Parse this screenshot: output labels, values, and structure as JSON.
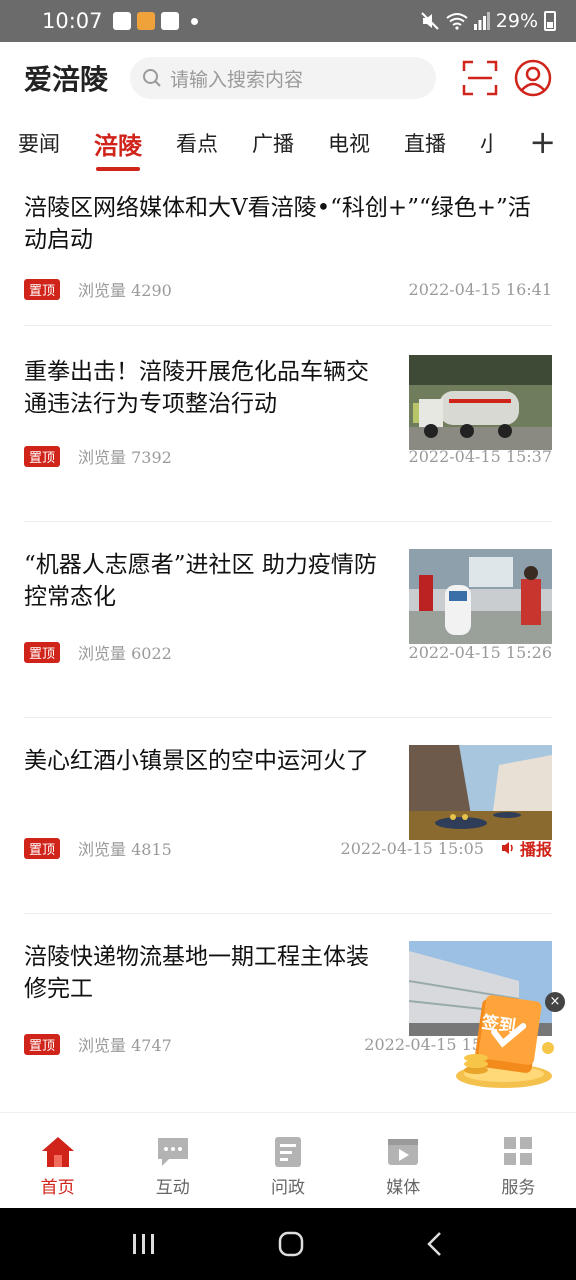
{
  "status_bar": {
    "time": "10:07",
    "battery": "29%"
  },
  "header": {
    "logo": "爱涪陵",
    "search_placeholder": "请输入搜索内容"
  },
  "tabs": [
    "要闻",
    "涪陵",
    "看点",
    "广播",
    "电视",
    "直播",
    "小"
  ],
  "active_tab": "涪陵",
  "tab_add": "+",
  "articles": [
    {
      "title": "涪陵区网络媒体和大V看涪陵•“科创+”“绿色+”活动启动",
      "badge": "置顶",
      "views": "浏览量 4290",
      "date": "2022-04-15  16:41"
    },
    {
      "title": "重拳出击！涪陵开展危化品车辆交通违法行为专项整治行动",
      "badge": "置顶",
      "views": "浏览量   7392",
      "date": "2022-04-15  15:37"
    },
    {
      "title": "“机器人志愿者”进社区  助力疫情防控常态化",
      "badge": "置顶",
      "views": "浏览量   6022",
      "date": "2022-04-15  15:26"
    },
    {
      "title": "美心红酒小镇景区的空中运河火了",
      "badge": "置顶",
      "views": "浏览量   4815",
      "date": "2022-04-15  15:05",
      "broadcast": "播报"
    },
    {
      "title": "涪陵快递物流基地一期工程主体装修完工",
      "badge": "置顶",
      "views": "浏览量   4747",
      "date": "2022-04-15  15"
    }
  ],
  "signin": {
    "label": "签到",
    "close": "×"
  },
  "bottom_nav": [
    {
      "label": "首页",
      "icon": "home-icon"
    },
    {
      "label": "互动",
      "icon": "chat-icon"
    },
    {
      "label": "问政",
      "icon": "form-icon"
    },
    {
      "label": "媒体",
      "icon": "play-icon"
    },
    {
      "label": "服务",
      "icon": "grid-icon"
    }
  ],
  "colors": {
    "accent": "#d0231a",
    "muted": "#9a9a9a"
  }
}
